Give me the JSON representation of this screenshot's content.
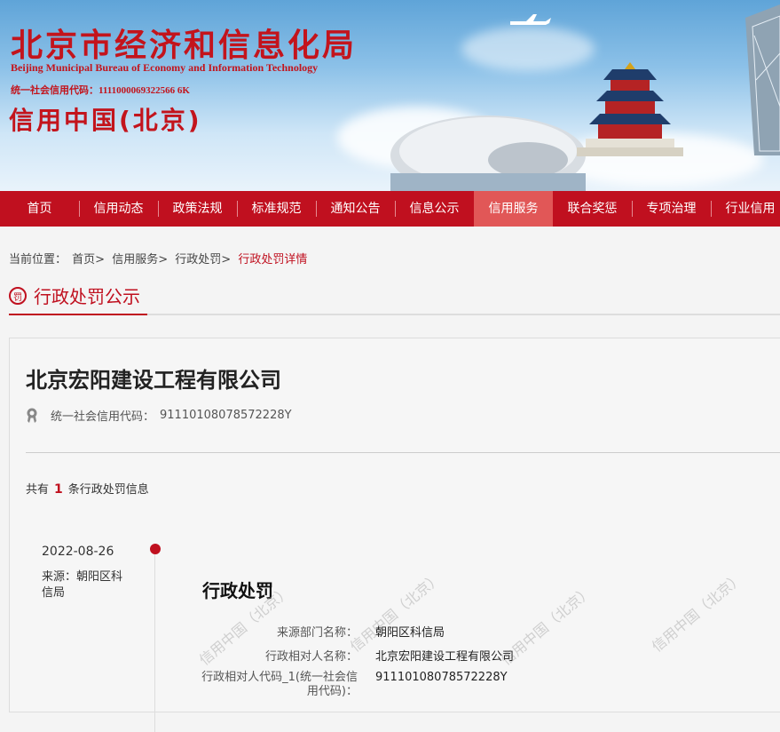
{
  "banner": {
    "title_cn": "北京市经济和信息化局",
    "title_en": "Beijing Municipal Bureau of Economy and Information Technology",
    "credit_code_line": "统一社会信用代码：1111000069322566 6K",
    "subtitle": "信用中国(北京)"
  },
  "nav": {
    "items": [
      {
        "label": "首页"
      },
      {
        "label": "信用动态"
      },
      {
        "label": "政策法规"
      },
      {
        "label": "标准规范"
      },
      {
        "label": "通知公告"
      },
      {
        "label": "信息公示"
      },
      {
        "label": "信用服务"
      },
      {
        "label": "联合奖惩"
      },
      {
        "label": "专项治理"
      },
      {
        "label": "行业信用"
      }
    ],
    "active_index": 6
  },
  "breadcrumb": {
    "prefix": "当前位置：",
    "items": [
      "首页",
      "信用服务",
      "行政处罚"
    ],
    "current": "行政处罚详情"
  },
  "section": {
    "badge": "罚",
    "title": "行政处罚公示"
  },
  "company": {
    "name": "北京宏阳建设工程有限公司",
    "code_label": "统一社会信用代码：",
    "code_value": "91110108078572228Y"
  },
  "count": {
    "prefix": "共有",
    "value": "1",
    "suffix": "条行政处罚信息"
  },
  "record": {
    "date": "2022-08-26",
    "source": "来源：朝阳区科信局",
    "title": "行政处罚",
    "fields": [
      {
        "key": "来源部门名称：",
        "value": "朝阳区科信局"
      },
      {
        "key": "行政相对人名称：",
        "value": "北京宏阳建设工程有限公司"
      },
      {
        "key": "行政相对人代码_1(统一社会信用代码)：",
        "value": "91110108078572228Y"
      }
    ]
  },
  "watermark": "信用中国（北京）",
  "colors": {
    "brand_red": "#c0101f",
    "nav_active": "#e15757"
  }
}
